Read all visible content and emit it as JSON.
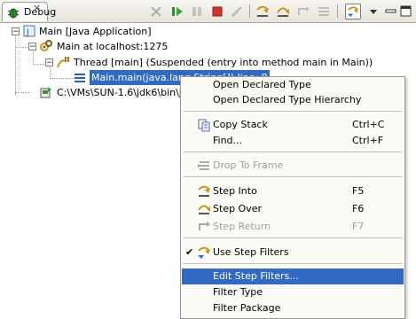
{
  "view": {
    "tab_label": "Debug",
    "toolbar": [
      {
        "name": "remove-terminated-icon",
        "enabled": false
      },
      {
        "name": "resume-icon",
        "enabled": true
      },
      {
        "name": "suspend-icon",
        "enabled": false
      },
      {
        "name": "terminate-icon",
        "enabled": true
      },
      {
        "name": "disconnect-icon",
        "enabled": false
      },
      {
        "name": "step-into-icon",
        "enabled": true
      },
      {
        "name": "step-over-icon",
        "enabled": true
      },
      {
        "name": "step-return-icon",
        "enabled": false
      },
      {
        "name": "drop-to-frame-icon",
        "enabled": false
      },
      {
        "name": "use-step-filters-icon",
        "enabled": true,
        "pressed": true
      },
      {
        "name": "view-menu-icon",
        "enabled": true
      },
      {
        "name": "minimize-icon",
        "enabled": true
      },
      {
        "name": "maximize-icon",
        "enabled": true
      }
    ]
  },
  "tree": {
    "launch": "Main [Java Application]",
    "target": "Main at localhost:1275",
    "thread": "Thread [main] (Suspended (entry into method main in Main))",
    "frame": "Main.main(java.lang.String[]) line: 8",
    "process": "C:\\VMs\\SUN-1.6\\jdk6\\bin\\javaw.exe"
  },
  "context_menu": {
    "items": [
      {
        "label": "Open Declared Type",
        "accel": "",
        "enabled": true,
        "icon": ""
      },
      {
        "label": "Open Declared Type Hierarchy",
        "accel": "",
        "enabled": true,
        "icon": ""
      },
      {
        "label": "Copy Stack",
        "accel": "Ctrl+C",
        "enabled": true,
        "icon": "copy-icon"
      },
      {
        "label": "Find...",
        "accel": "Ctrl+F",
        "enabled": true,
        "icon": ""
      },
      {
        "label": "Drop To Frame",
        "accel": "",
        "enabled": false,
        "icon": "drop-to-frame-icon"
      },
      {
        "label": "Step Into",
        "accel": "F5",
        "enabled": true,
        "icon": "step-into-icon"
      },
      {
        "label": "Step Over",
        "accel": "F6",
        "enabled": true,
        "icon": "step-over-icon"
      },
      {
        "label": "Step Return",
        "accel": "F7",
        "enabled": false,
        "icon": "step-return-icon"
      },
      {
        "label": "Use Step Filters",
        "accel": "",
        "enabled": true,
        "checked": true,
        "icon": "use-step-filters-icon"
      },
      {
        "label": "Edit Step Filters...",
        "accel": "",
        "enabled": true,
        "highlighted": true,
        "icon": ""
      },
      {
        "label": "Filter Type",
        "accel": "",
        "enabled": true,
        "icon": ""
      },
      {
        "label": "Filter Package",
        "accel": "",
        "enabled": true,
        "icon": ""
      }
    ]
  },
  "colors": {
    "selection": "#316ac5",
    "menu_background": "#fbfaf7",
    "disabled_text": "#a19f9a"
  }
}
